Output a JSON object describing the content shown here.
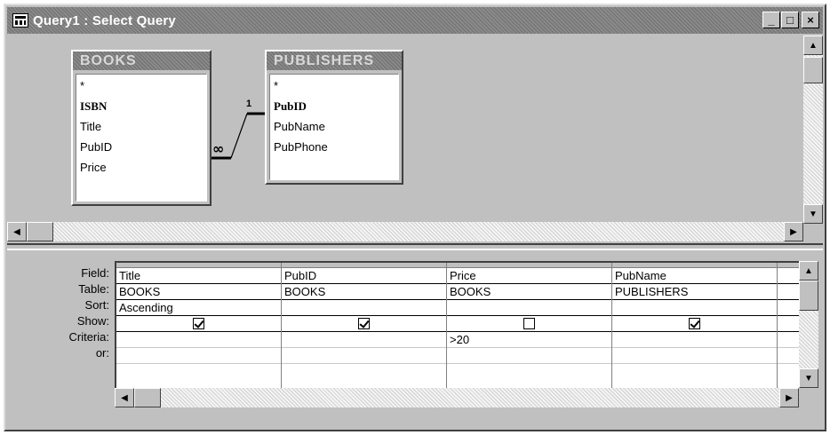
{
  "window": {
    "title": "Query1 : Select Query",
    "buttons": {
      "minimize": "_",
      "maximize": "□",
      "close": "×"
    }
  },
  "tables": [
    {
      "name": "BOOKS",
      "fields": [
        "*",
        "ISBN",
        "Title",
        "PubID",
        "Price"
      ],
      "key_field": "ISBN"
    },
    {
      "name": "PUBLISHERS",
      "fields": [
        "*",
        "PubID",
        "PubName",
        "PubPhone"
      ],
      "key_field": "PubID"
    }
  ],
  "relationship": {
    "one_label": "1",
    "many_label": "∞"
  },
  "grid": {
    "row_labels": [
      "Field:",
      "Table:",
      "Sort:",
      "Show:",
      "Criteria:",
      "or:"
    ],
    "columns": [
      {
        "field": "Title",
        "table": "BOOKS",
        "sort": "Ascending",
        "show": true,
        "criteria": "",
        "or": ""
      },
      {
        "field": "PubID",
        "table": "BOOKS",
        "sort": "",
        "show": true,
        "criteria": "",
        "or": ""
      },
      {
        "field": "Price",
        "table": "BOOKS",
        "sort": "",
        "show": false,
        "criteria": ">20",
        "or": ""
      },
      {
        "field": "PubName",
        "table": "PUBLISHERS",
        "sort": "",
        "show": true,
        "criteria": "",
        "or": ""
      },
      {
        "field": "",
        "table": "",
        "sort": "",
        "show": null,
        "criteria": "",
        "or": ""
      }
    ]
  },
  "icons": {
    "scroll_up": "▲",
    "scroll_down": "▼",
    "scroll_left": "◀",
    "scroll_right": "▶"
  }
}
